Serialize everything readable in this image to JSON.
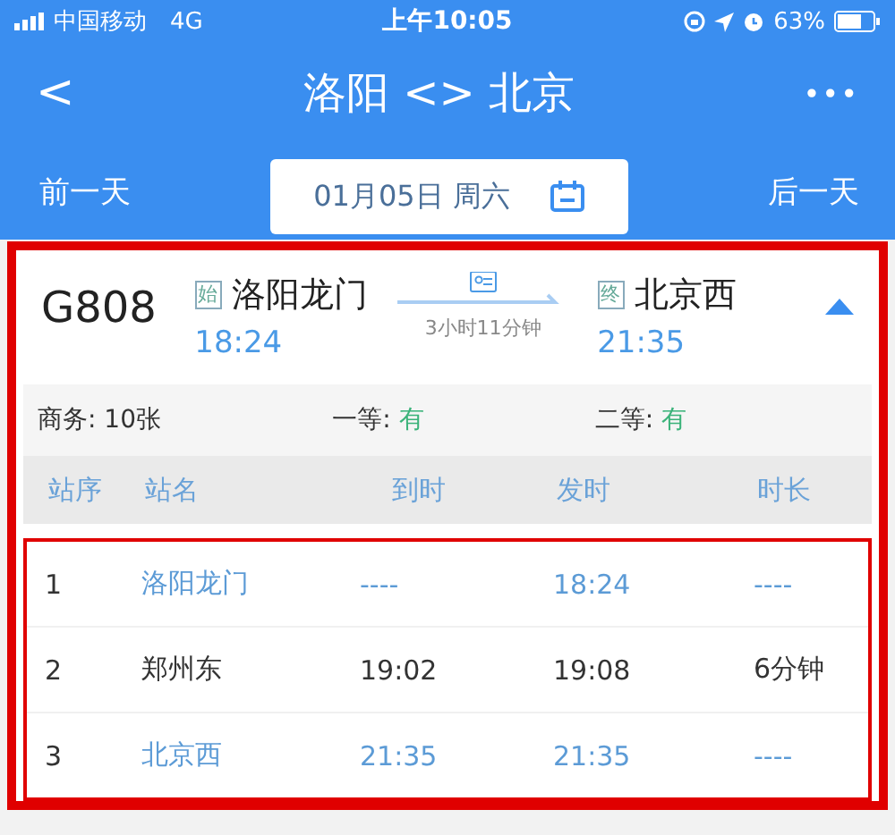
{
  "status_bar": {
    "carrier": "中国移动",
    "network": "4G",
    "time": "上午10:05",
    "battery": "63%"
  },
  "nav": {
    "back": "<",
    "title": "洛阳 <> 北京",
    "more": "•••"
  },
  "date_bar": {
    "prev": "前一天",
    "date": "01月05日 周六",
    "next": "后一天"
  },
  "train": {
    "number": "G808",
    "from_tag": "始",
    "from": "洛阳龙门",
    "depart": "18:24",
    "duration": "3小时11分钟",
    "to_tag": "终",
    "to": "北京西",
    "arrive": "21:35",
    "expanded": true
  },
  "seats": [
    {
      "label": "商务: ",
      "value": "10张",
      "kind": "count"
    },
    {
      "label": "一等: ",
      "value": "有",
      "kind": "available"
    },
    {
      "label": "二等: ",
      "value": "有",
      "kind": "available"
    }
  ],
  "table": {
    "columns": [
      "站序",
      "站名",
      "到时",
      "发时",
      "时长"
    ],
    "rows": [
      {
        "kind": "terminal",
        "cells": [
          "1",
          "洛阳龙门",
          "----",
          "18:24",
          "----"
        ]
      },
      {
        "kind": "stop",
        "cells": [
          "2",
          "郑州东",
          "19:02",
          "19:08",
          "6分钟"
        ]
      },
      {
        "kind": "terminal",
        "cells": [
          "3",
          "北京西",
          "21:35",
          "21:35",
          "----"
        ]
      }
    ]
  }
}
